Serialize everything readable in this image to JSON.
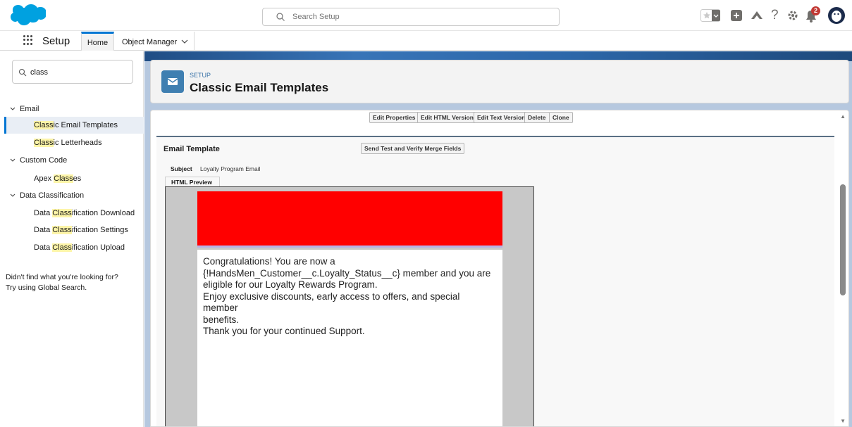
{
  "header": {
    "search_placeholder": "Search Setup",
    "notifications_count": "2"
  },
  "nav": {
    "app_name": "Setup",
    "tabs": [
      {
        "label": "Home"
      },
      {
        "label": "Object Manager"
      }
    ]
  },
  "sidebar": {
    "quick_find_value": "class",
    "sections": [
      {
        "label": "Email"
      },
      {
        "label": "Custom Code"
      },
      {
        "label": "Data Classification"
      }
    ],
    "not_found_line1": "Didn't find what you're looking for?",
    "not_found_line2": "Try using Global Search."
  },
  "page": {
    "eyebrow": "SETUP",
    "title": "Classic Email Templates"
  },
  "toolbar": {
    "edit_properties": "Edit Properties",
    "edit_html_version": "Edit HTML Version",
    "edit_text_version": "Edit Text Version",
    "delete": "Delete",
    "clone": "Clone"
  },
  "template": {
    "section_label": "Email Template",
    "send_test_label": "Send Test and Verify Merge Fields",
    "subject_label": "Subject",
    "subject_value": "Loyalty Program Email",
    "preview_tab": "HTML Preview",
    "body_lines": [
      "Congratulations! You are now a",
      "{!HandsMen_Customer__c.Loyalty_Status__c} member and you are",
      "eligible for our Loyalty Rewards Program.",
      "Enjoy exclusive discounts, early access to offers, and special member",
      "benefits.",
      "Thank you for your continued Support."
    ]
  },
  "colors": {
    "brand_blue": "#0176d3",
    "banner_red": "#ff0000",
    "highlight": "#fdf5a8"
  }
}
